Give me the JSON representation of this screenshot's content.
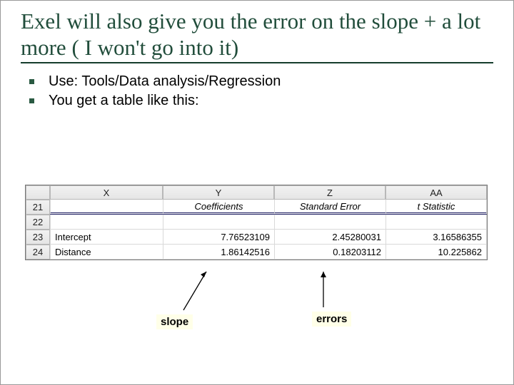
{
  "title": "Exel will also give you the error on the slope + a lot more ( I won't go into it)",
  "bullets": [
    "Use: Tools/Data analysis/Regression",
    "You get a table like this:"
  ],
  "spreadsheet": {
    "col_headers": {
      "X": "X",
      "Y": "Y",
      "Z": "Z",
      "AA": "AA"
    },
    "row_numbers": [
      "21",
      "22",
      "23",
      "24"
    ],
    "header_row": {
      "coefficients": "Coefficients",
      "std_error": "Standard Error",
      "t_stat": "t Statistic"
    },
    "data": {
      "intercept": {
        "label": "Intercept",
        "coef": "7.76523109",
        "se": "2.45280031",
        "t": "3.16586355"
      },
      "distance": {
        "label": "Distance",
        "coef": "1.86142516",
        "se": "0.18203112",
        "t": "10.225862"
      }
    }
  },
  "callouts": {
    "slope": "slope",
    "errors": "errors"
  }
}
